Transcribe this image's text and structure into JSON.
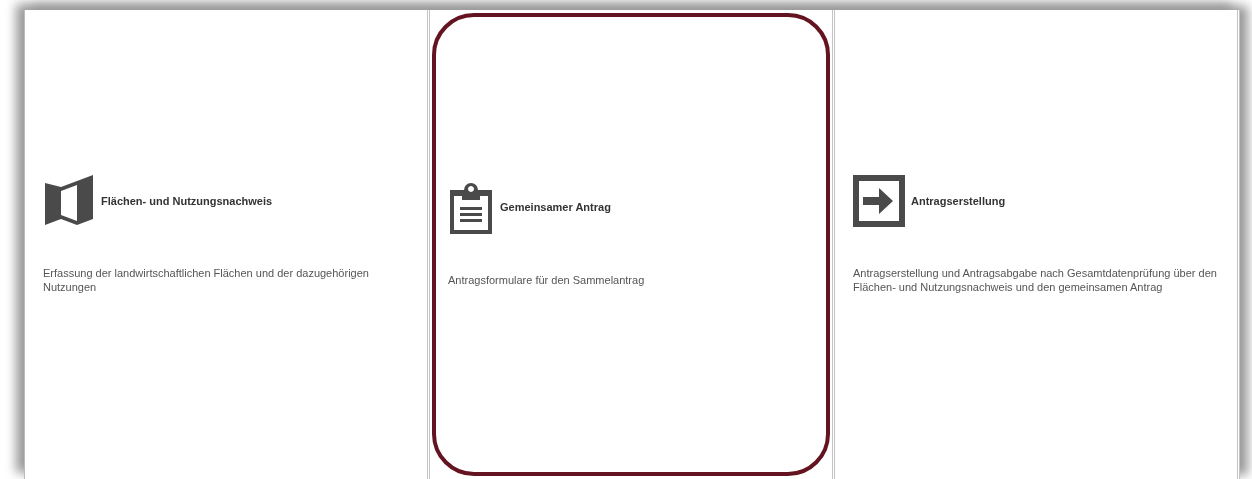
{
  "tiles": [
    {
      "kind": "map",
      "title": "Flächen- und Nutzungsnachweis",
      "description": "Erfassung der landwirtschaftlichen Flächen und der dazugehörigen Nutzungen",
      "selected": false
    },
    {
      "kind": "clipboard",
      "title": "Gemeinsamer Antrag",
      "description": "Antragsformulare für den Sammelantrag",
      "selected": true
    },
    {
      "kind": "arrow",
      "title": "Antragserstellung",
      "description": "Antragserstellung und Antragsabgabe nach Gesamtdatenprüfung über den Flächen- und Nutzungsnachweis und den gemeinsamen Antrag",
      "selected": false
    }
  ]
}
